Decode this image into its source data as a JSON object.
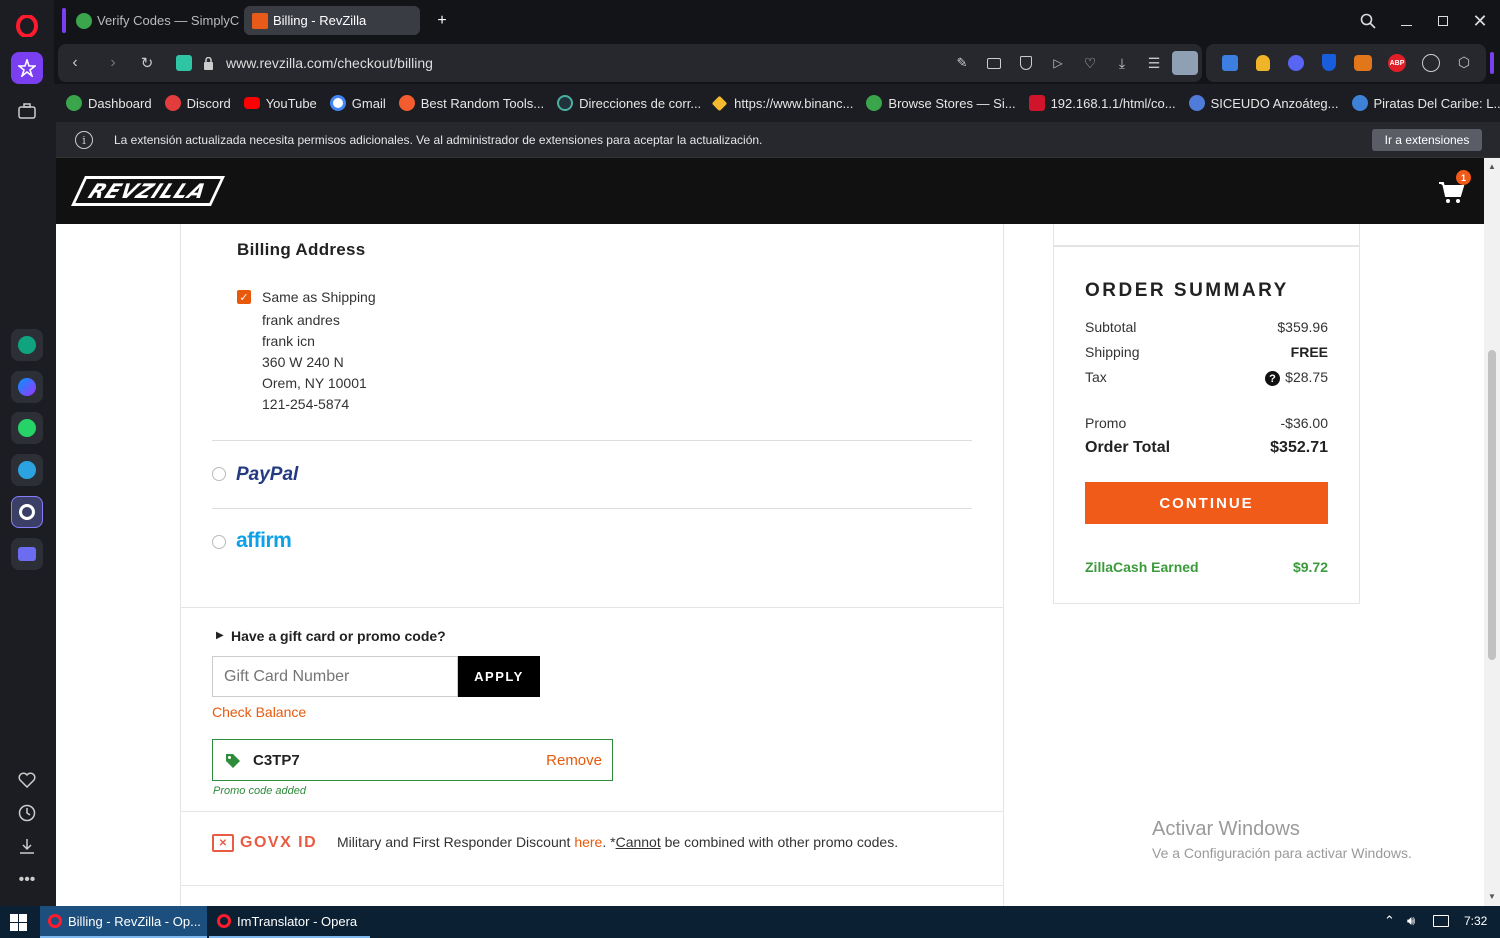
{
  "browser": {
    "tabs": [
      {
        "label": "Verify Codes — SimplyCod"
      },
      {
        "label": "Billing - RevZilla"
      }
    ],
    "url": "www.revzilla.com/checkout/billing",
    "bookmarks": [
      {
        "label": "Dashboard"
      },
      {
        "label": "Discord"
      },
      {
        "label": "YouTube"
      },
      {
        "label": "Gmail"
      },
      {
        "label": "Best Random Tools..."
      },
      {
        "label": "Direcciones de corr..."
      },
      {
        "label": "https://www.binanc..."
      },
      {
        "label": "Browse Stores — Si..."
      },
      {
        "label": "192.168.1.1/html/co..."
      },
      {
        "label": "SICEUDO Anzoáteg..."
      },
      {
        "label": "Piratas Del Caribe: L..."
      }
    ],
    "notice": {
      "text": "La extensión actualizada necesita permisos adicionales. Ve al administrador de extensiones para aceptar la actualización.",
      "button": "Ir a extensiones"
    }
  },
  "site": {
    "logo": "REVZILLA",
    "cart_count": "1"
  },
  "billing": {
    "title": "Billing Address",
    "same_as_shipping": "Same as Shipping",
    "address_lines": [
      "frank andres",
      "frank icn",
      "360 W 240 N",
      "Orem, NY 10001",
      "121-254-5874"
    ],
    "paypal": "PayPal",
    "affirm": "affirm"
  },
  "promo": {
    "toggle": "Have a gift card or promo code?",
    "placeholder": "Gift Card Number",
    "apply": "APPLY",
    "check_balance": "Check Balance",
    "code": "C3TP7",
    "remove": "Remove",
    "added": "Promo code added"
  },
  "govx": {
    "logo": "GOVX ID",
    "text_before": "Military and First Responder Discount ",
    "link": "here",
    "text_mid": ". *",
    "cannot": "Cannot",
    "text_after": " be combined with other promo codes."
  },
  "summary": {
    "title": "ORDER SUMMARY",
    "subtotal_label": "Subtotal",
    "subtotal": "$359.96",
    "shipping_label": "Shipping",
    "shipping": "FREE",
    "tax_label": "Tax",
    "tax": "$28.75",
    "promo_label": "Promo",
    "promo": "-$36.00",
    "total_label": "Order Total",
    "total": "$352.71",
    "continue": "CONTINUE",
    "zillacash_label": "ZillaCash Earned",
    "zillacash": "$9.72"
  },
  "watermark": {
    "title": "Activar Windows",
    "subtitle": "Ve a Configuración para activar Windows."
  },
  "taskbar": {
    "items": [
      {
        "label": "Billing - RevZilla - Op..."
      },
      {
        "label": "ImTranslator - Opera"
      }
    ],
    "time": "7:32"
  },
  "colors": {
    "accent": "#f05b1a",
    "green": "#2e8b3a",
    "zillacash": "#3b9b3b",
    "paypal_dark": "#253b80",
    "paypal_light": "#179bd7"
  }
}
